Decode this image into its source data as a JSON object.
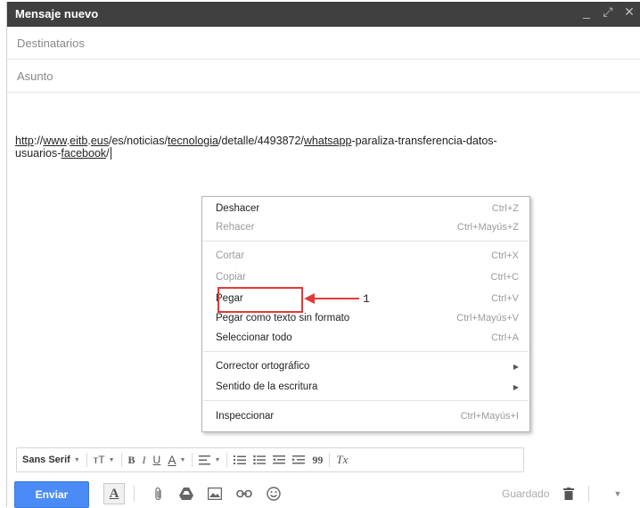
{
  "window": {
    "title": "Mensaje nuevo",
    "controls": {
      "minimize": "_",
      "expand": "⤢",
      "close": "✕"
    }
  },
  "fields": {
    "to_placeholder": "Destinatarios",
    "subject_placeholder": "Asunto"
  },
  "body": {
    "seg1": "http",
    "seg2": "://",
    "seg3": "www",
    "seg4": ".",
    "seg5": "eitb",
    "seg6": ".",
    "seg7": "eus",
    "seg8": "/es/noticias/",
    "seg9": "tecnologia",
    "seg10": "/detalle/4493872/",
    "seg11": "whatsapp",
    "seg12": "-paraliza-transferencia-datos-",
    "seg13": "usuarios-",
    "seg14": "facebook",
    "seg15": "/"
  },
  "context_menu": {
    "items": [
      {
        "label": "Deshacer",
        "shortcut": "Ctrl+Z",
        "enabled": true
      },
      {
        "label": "Rehacer",
        "shortcut": "Ctrl+Mayús+Z",
        "enabled": false
      },
      {
        "label": "Cortar",
        "shortcut": "Ctrl+X",
        "enabled": false
      },
      {
        "label": "Copiar",
        "shortcut": "Ctrl+C",
        "enabled": false
      },
      {
        "label": "Pegar",
        "shortcut": "Ctrl+V",
        "enabled": true
      },
      {
        "label": "Pegar como texto sin formato",
        "shortcut": "Ctrl+Mayús+V",
        "enabled": true
      },
      {
        "label": "Seleccionar todo",
        "shortcut": "Ctrl+A",
        "enabled": true
      },
      {
        "label": "Corrector ortográfico",
        "shortcut": "",
        "enabled": true
      },
      {
        "label": "Sentido de la escritura",
        "shortcut": "",
        "enabled": true
      },
      {
        "label": "Inspeccionar",
        "shortcut": "Ctrl+Mayús+I",
        "enabled": true
      }
    ],
    "annotation_number": "1",
    "highlight_color": "#e23a3a"
  },
  "format_toolbar": {
    "font": "Sans Serif",
    "size": "тT",
    "bold": "B",
    "italic": "I",
    "underline": "U",
    "text_color": "A",
    "quote": "99",
    "clear_format": "Tx"
  },
  "bottom_toolbar": {
    "send_label": "Enviar",
    "formatting": "A",
    "saved_label": "Guardado"
  },
  "colors": {
    "titlebar": "#404040",
    "send_button": "#4a8bf5",
    "annotation": "#e23a3a"
  }
}
